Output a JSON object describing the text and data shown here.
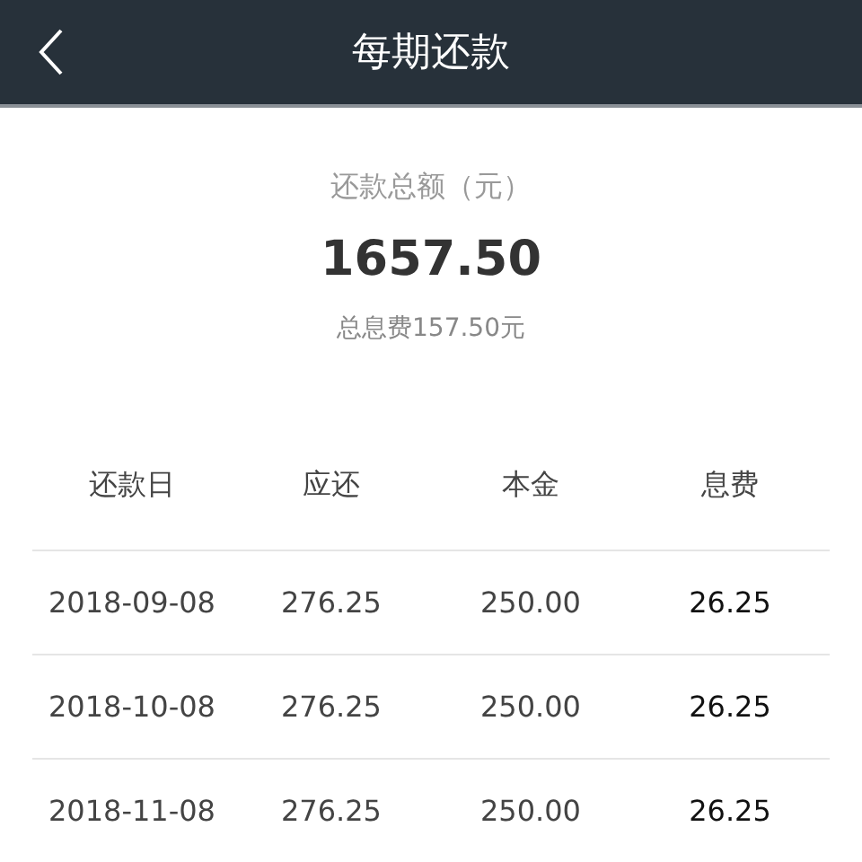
{
  "header": {
    "title": "每期还款"
  },
  "summary": {
    "label": "还款总额（元）",
    "amount": "1657.50",
    "interest": "总息费157.50元"
  },
  "table": {
    "columns": [
      "还款日",
      "应还",
      "本金",
      "息费"
    ],
    "rows": [
      [
        "2018-09-08",
        "276.25",
        "250.00",
        "26.25"
      ],
      [
        "2018-10-08",
        "276.25",
        "250.00",
        "26.25"
      ],
      [
        "2018-11-08",
        "276.25",
        "250.00",
        "26.25"
      ]
    ]
  }
}
